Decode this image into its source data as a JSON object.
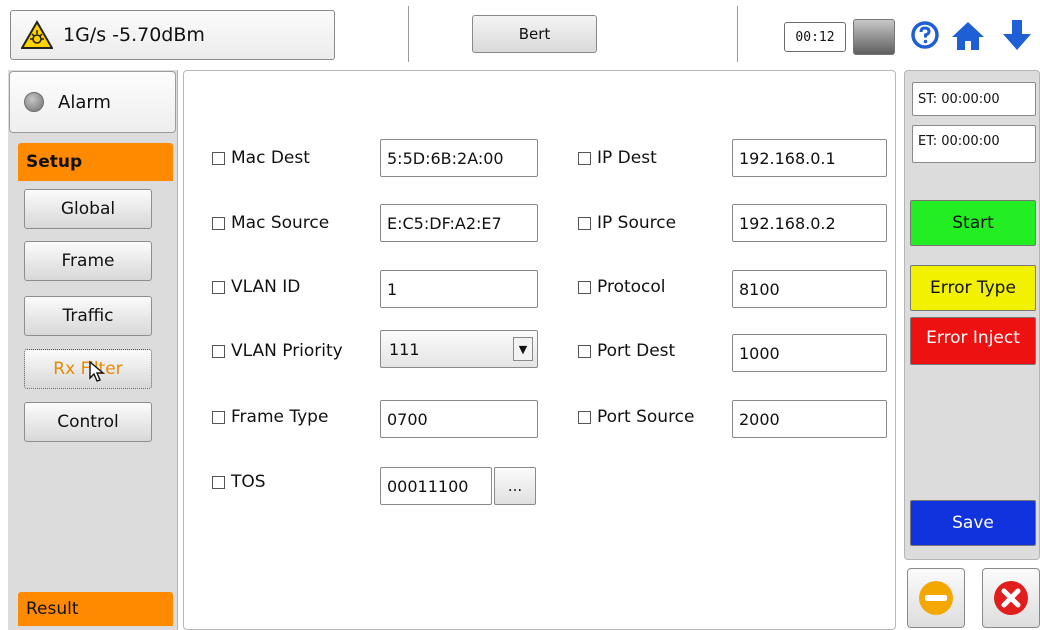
{
  "header": {
    "status_text": "1G/s -5.70dBm",
    "mode_button": "Bert",
    "clock": "00:12"
  },
  "sidebar": {
    "alarm_label": "Alarm",
    "setup_tab": "Setup",
    "items": [
      {
        "label": "Global"
      },
      {
        "label": "Frame"
      },
      {
        "label": "Traffic"
      },
      {
        "label": "Rx Filter"
      },
      {
        "label": "Control"
      }
    ],
    "active_item": "Rx Filter",
    "result_tab": "Result"
  },
  "form": {
    "mac_dest": {
      "label": "Mac Dest",
      "value": "5:5D:6B:2A:00"
    },
    "mac_source": {
      "label": "Mac Source",
      "value": "E:C5:DF:A2:E7"
    },
    "vlan_id": {
      "label": "VLAN ID",
      "value": "1"
    },
    "vlan_priority": {
      "label": "VLAN Priority",
      "value": "111"
    },
    "frame_type": {
      "label": "Frame Type",
      "value": "0700"
    },
    "tos": {
      "label": "TOS",
      "value": "00011100",
      "more": "..."
    },
    "ip_dest": {
      "label": "IP Dest",
      "value": "192.168.0.1"
    },
    "ip_source": {
      "label": "IP Source",
      "value": "192.168.0.2"
    },
    "protocol": {
      "label": "Protocol",
      "value": "8100"
    },
    "port_dest": {
      "label": "Port Dest",
      "value": "1000"
    },
    "port_source": {
      "label": "Port Source",
      "value": "2000"
    }
  },
  "controls": {
    "start_time": "ST: 00:00:00",
    "end_time": "ET: 00:00:00",
    "start_label": "Start",
    "error_type_label": "Error Type",
    "error_inject_label": "Error Inject",
    "save_label": "Save"
  },
  "colors": {
    "accent_orange": "#ff8a00",
    "start_green": "#22ee22",
    "error_type_yellow": "#f2f200",
    "error_inject_red": "#ee1111",
    "save_blue": "#1133dd"
  },
  "icons": [
    "laser-warning-icon",
    "help-icon",
    "home-icon",
    "download-arrow-icon",
    "battery-icon",
    "minimize-icon",
    "close-icon"
  ]
}
